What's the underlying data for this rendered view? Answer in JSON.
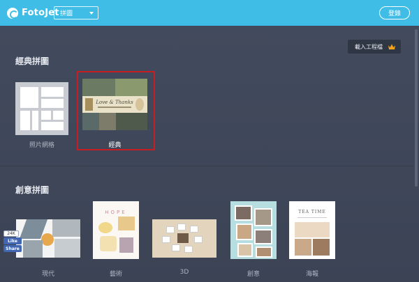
{
  "header": {
    "logo_text": "FotoJet",
    "mode_select_value": "拼圖",
    "login_label": "登錄"
  },
  "toolbar": {
    "load_project_label": "載入工程檔"
  },
  "sections": {
    "classic_title": "經典拼圖",
    "creative_title": "創意拼圖"
  },
  "classic_cards": [
    {
      "label": "照片網格",
      "icon": "photo-grid-icon"
    },
    {
      "label": "經典",
      "selected": true,
      "banner_text": "Love & Thanks"
    }
  ],
  "creative_cards": [
    {
      "label": "現代"
    },
    {
      "label": "藝術",
      "banner_text": "HOPE"
    },
    {
      "label": "3D"
    },
    {
      "label": "創意"
    },
    {
      "label": "海報",
      "banner_text": "TEA TIME"
    }
  ],
  "social": {
    "count": "24K",
    "like_label": "Like",
    "share_label": "Share"
  },
  "colors": {
    "header": "#3fbde6",
    "panel": "#3d4658",
    "selection": "#c81e23",
    "crown": "#f0a21a"
  }
}
